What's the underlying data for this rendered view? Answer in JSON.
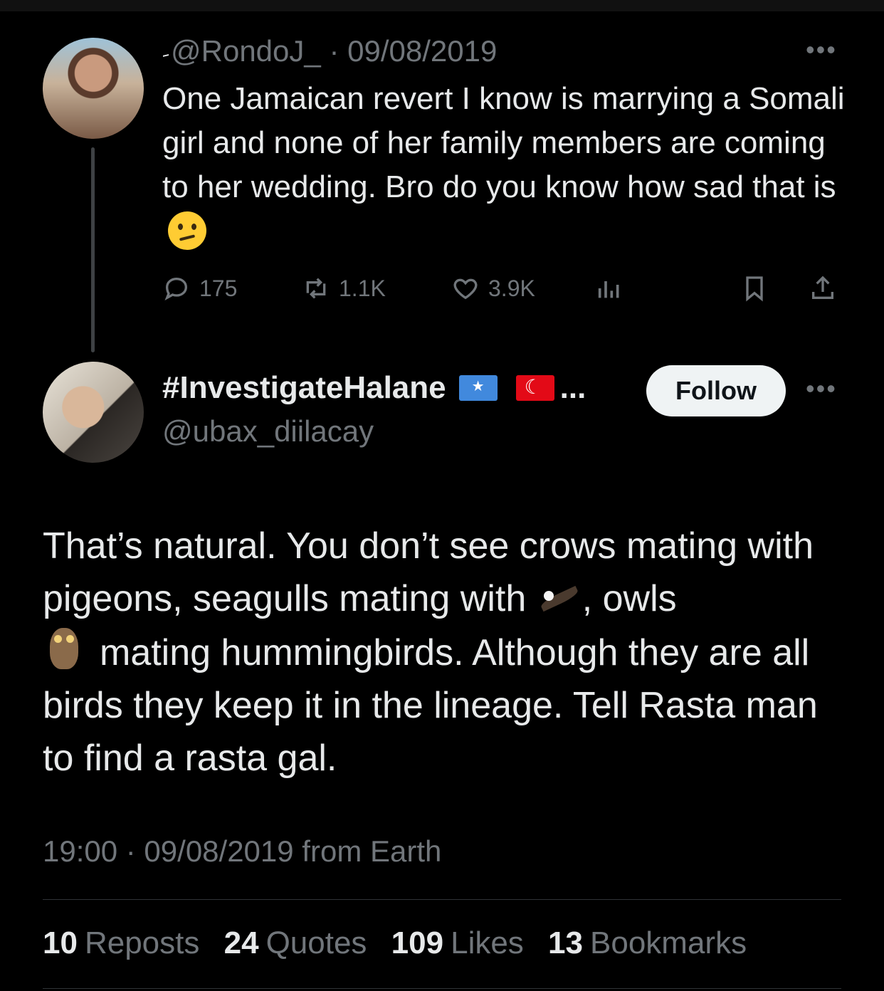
{
  "parent_tweet": {
    "name": "ِ",
    "handle": "@RondoJ_",
    "separator": "·",
    "date": "09/08/2019",
    "text": "One Jamaican revert I know is marrying a Somali girl and none of her family members are coming to her wedding. Bro do you know how sad that is",
    "emoji": "confused-face-emoji",
    "more": "•••",
    "actions": {
      "replies": "175",
      "reposts": "1.1K",
      "likes": "3.9K"
    },
    "icons": [
      "reply-icon",
      "repost-icon",
      "like-icon",
      "views-icon",
      "bookmark-icon",
      "share-icon"
    ]
  },
  "main_tweet": {
    "display_name": "#InvestigateHalane",
    "name_ellipsis": "...",
    "flags": [
      "somalia-flag-icon",
      "turkey-flag-icon"
    ],
    "handle": "@ubax_diilacay",
    "follow_label": "Follow",
    "more": "•••",
    "text": {
      "part1": "That’s natural. You don’t see crows mating with pigeons, seagulls mating with",
      "part2": ", owls",
      "part3": "mating hummingbirds. Although they are all birds they keep it in the lineage. Tell Rasta man to find a rasta gal."
    },
    "emojis": [
      "eagle-emoji",
      "owl-emoji"
    ],
    "timestamp": "19:00 · 09/08/2019 from Earth",
    "stats": [
      {
        "count": "10",
        "label": "Reposts"
      },
      {
        "count": "24",
        "label": "Quotes"
      },
      {
        "count": "109",
        "label": "Likes"
      },
      {
        "count": "13",
        "label": "Bookmarks"
      }
    ]
  },
  "colors": {
    "background": "#000000",
    "text": "#e7e9ea",
    "secondary": "#71767b",
    "divider": "#2f3336",
    "follow_bg": "#eff3f4"
  }
}
